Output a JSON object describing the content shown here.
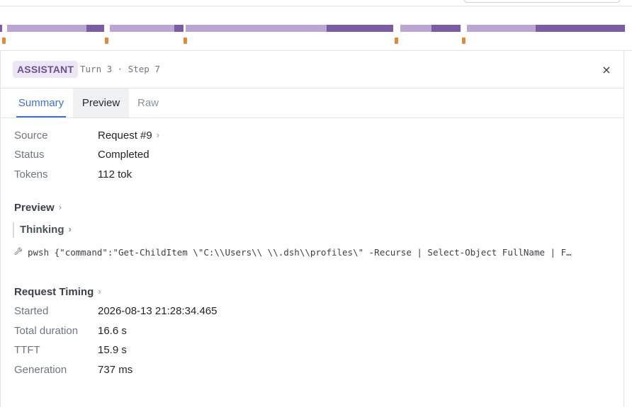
{
  "header": {
    "role": "ASSISTANT",
    "turn_step": "Turn 3 · Step 7",
    "close_glyph": "×"
  },
  "tabs": [
    {
      "label": "Summary",
      "active": true
    },
    {
      "label": "Preview",
      "active": false
    },
    {
      "label": "Raw",
      "active": false
    }
  ],
  "summary": [
    {
      "key": "Source",
      "value": "Request #9"
    },
    {
      "key": "Status",
      "value": "Completed"
    },
    {
      "key": "Tokens",
      "value": "112 tok"
    }
  ],
  "preview": {
    "title": "Preview",
    "thinking_label": "Thinking",
    "tool_icon": "wrench-icon",
    "tool_name": "pwsh",
    "tool_args": "{\"command\":\"Get-ChildItem \\\"C:\\\\Users\\\\      \\\\.dsh\\\\profiles\\\" -Recurse | Select-Object FullName | F…"
  },
  "timing": {
    "title": "Request Timing",
    "rows": [
      {
        "key": "Started",
        "value": "2026-08-13 21:28:34.465"
      },
      {
        "key": "Total duration",
        "value": "16.6 s"
      },
      {
        "key": "TTFT",
        "value": "15.9 s"
      },
      {
        "key": "Generation",
        "value": "737 ms"
      }
    ]
  },
  "colors": {
    "accent": "#3d6fd6",
    "timeline_light": "#b9a6d3",
    "timeline_dark": "#7b5ba6",
    "timeline_tick": "#dd8a3a",
    "role_badge_bg": "#ece6f4",
    "role_badge_fg": "#6b4f96"
  }
}
